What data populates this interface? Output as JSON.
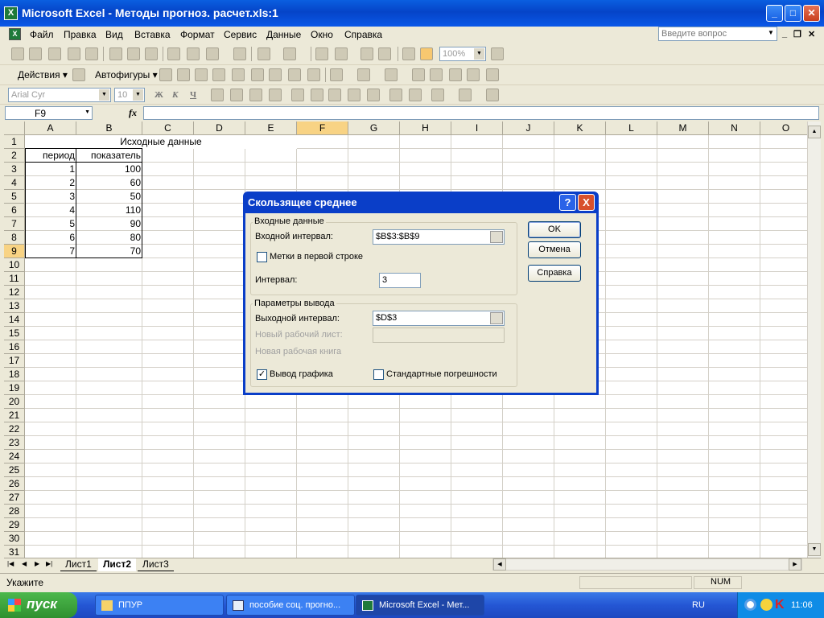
{
  "window": {
    "title": "Microsoft Excel - Методы прогноз. расчет.xls:1"
  },
  "menu": [
    "Файл",
    "Правка",
    "Вид",
    "Вставка",
    "Формат",
    "Сервис",
    "Данные",
    "Окно",
    "Справка"
  ],
  "help_placeholder": "Введите вопрос",
  "toolbar": {
    "zoom": "100%",
    "draw_label": "Действия",
    "autoshapes_label": "Автофигуры",
    "font": "Arial Cyr",
    "font_size": "10"
  },
  "name_box": "F9",
  "fx": "fx",
  "columns": [
    "A",
    "B",
    "C",
    "D",
    "E",
    "F",
    "G",
    "H",
    "I",
    "J",
    "K",
    "L",
    "M",
    "N",
    "O"
  ],
  "rows": [
    "1",
    "2",
    "3",
    "4",
    "5",
    "6",
    "7",
    "8",
    "9",
    "10",
    "11",
    "12",
    "13",
    "14",
    "15",
    "16",
    "17",
    "18",
    "19",
    "20",
    "21",
    "22",
    "23",
    "24",
    "25",
    "26",
    "27",
    "28",
    "29",
    "30",
    "31"
  ],
  "sheet": {
    "title": "Исходные данные",
    "header_period": "период",
    "header_value": "показатель",
    "data": [
      {
        "period": "1",
        "value": "100"
      },
      {
        "period": "2",
        "value": "60"
      },
      {
        "period": "3",
        "value": "50"
      },
      {
        "period": "4",
        "value": "110"
      },
      {
        "period": "5",
        "value": "90"
      },
      {
        "period": "6",
        "value": "80"
      },
      {
        "period": "7",
        "value": "70"
      }
    ]
  },
  "tabs": [
    "Лист1",
    "Лист2",
    "Лист3"
  ],
  "status": {
    "text": "Укажите",
    "num": "NUM"
  },
  "taskbar": {
    "start": "пуск",
    "items": [
      "ППУР",
      "пособие соц. прогно...",
      "Microsoft Excel - Мет..."
    ],
    "lang": "RU",
    "clock": "11:06"
  },
  "dialog": {
    "title": "Скользящее среднее",
    "input_group": "Входные данные",
    "input_range_label": "Входной интервал:",
    "input_range_value": "$B$3:$B$9",
    "labels_label": "Метки в первой строке",
    "interval_label": "Интервал:",
    "interval_value": "3",
    "output_group": "Параметры вывода",
    "output_range_label": "Выходной интервал:",
    "output_range_value": "$D$3",
    "new_sheet_label": "Новый рабочий лист:",
    "new_book_label": "Новая рабочая книга",
    "chart_label": "Вывод графика",
    "stderr_label": "Стандартные погрешности",
    "ok": "OK",
    "cancel": "Отмена",
    "help": "Справка",
    "help_btn": "?",
    "close_btn": "X"
  },
  "colors": {
    "title_bar": "#0a4fd8",
    "selection": "#f8d384",
    "start": "#3c9c3c"
  }
}
